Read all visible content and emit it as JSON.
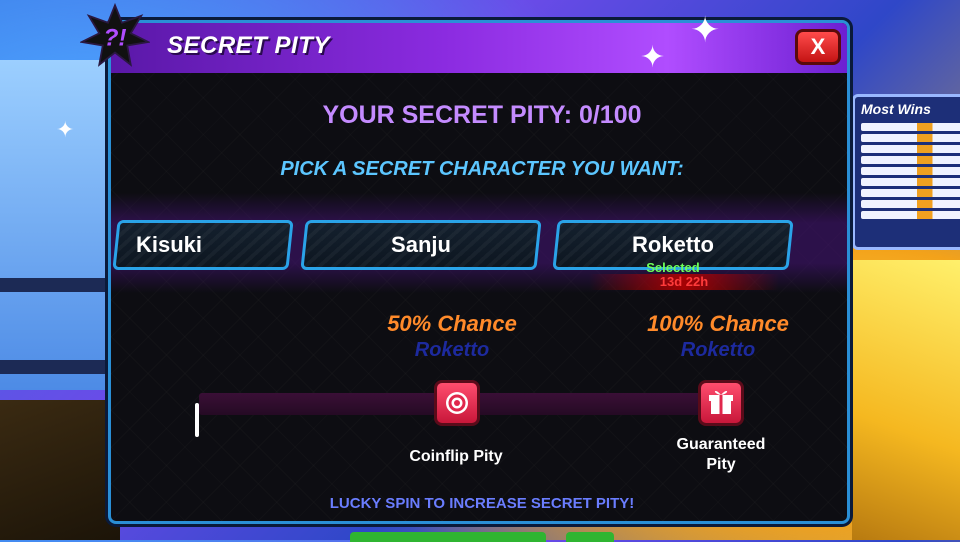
{
  "dialog": {
    "title": "SECRET PITY",
    "close_label": "X",
    "pity_status": "YOUR SECRET PITY: 0/100",
    "pity_current": 0,
    "pity_max": 100,
    "pick_prompt": "PICK A SECRET CHARACTER YOU WANT:",
    "characters": [
      {
        "name": "Kisuki"
      },
      {
        "name": "Sanju"
      },
      {
        "name": "Roketto"
      }
    ],
    "selected_label": "Selected",
    "timer": "13d 22h",
    "milestones": [
      {
        "chance": "50% Chance",
        "character": "Roketto",
        "label": "Coinflip Pity"
      },
      {
        "chance": "100% Chance",
        "character": "Roketto",
        "label_line1": "Guaranteed",
        "label_line2": "Pity"
      }
    ],
    "footer": "LUCKY SPIN TO INCREASE SECRET PITY!"
  },
  "background": {
    "board_title": "Most Wins"
  },
  "colors": {
    "panel_border": "#2a8fd6",
    "title_bar": "#8b2be0",
    "pity_text": "#c48bff",
    "prompt_text": "#5cc6ff",
    "chance_text": "#ff8a2a",
    "selected_text": "#6dff5a",
    "timer_text": "#ff3b3b",
    "milestone": "#e0284c"
  }
}
